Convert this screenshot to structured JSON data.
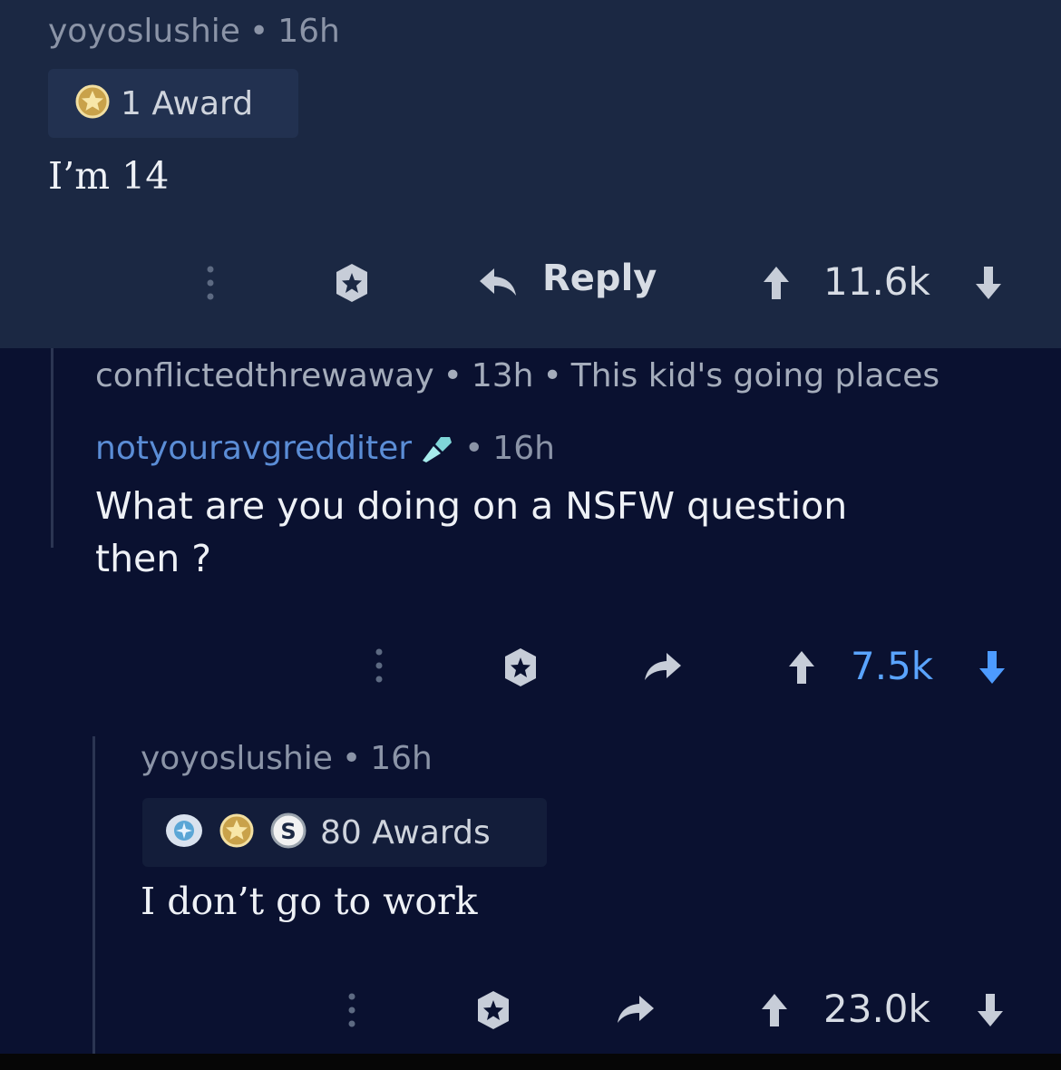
{
  "comment1": {
    "username": "yoyoslushie",
    "separator": "•",
    "age": "16h",
    "awards_label": "1 Award",
    "body": "I’m 14",
    "reply_label": "Reply",
    "score": "11.6k"
  },
  "collapsed": {
    "username": "conflictedthrewaway",
    "separator": "•",
    "age": "13h",
    "body": "This kid's going places"
  },
  "comment2": {
    "username": "notyouravgredditer",
    "separator": "•",
    "age": "16h",
    "body_line1": "What are you doing on a NSFW question",
    "body_line2": "then ?",
    "score": "7.5k",
    "vote_state": "downvoted",
    "vote_color": "#5aa4ff"
  },
  "comment3": {
    "username": "yoyoslushie",
    "separator": "•",
    "age": "16h",
    "awards_label": "80 Awards",
    "body": "I don’t go to work",
    "score": "23.0k"
  },
  "icons": [
    "more-options-icon",
    "award-icon",
    "reply-icon",
    "upvote-icon",
    "downvote-icon",
    "brush-flair-icon",
    "gold-award-icon",
    "silver-award-icon",
    "s-coin-award-icon"
  ],
  "colors": {
    "top_background": "#1b2843",
    "main_background": "#0a1130",
    "accent_blue": "#5aa4ff",
    "username_link": "#5b8dd6"
  }
}
